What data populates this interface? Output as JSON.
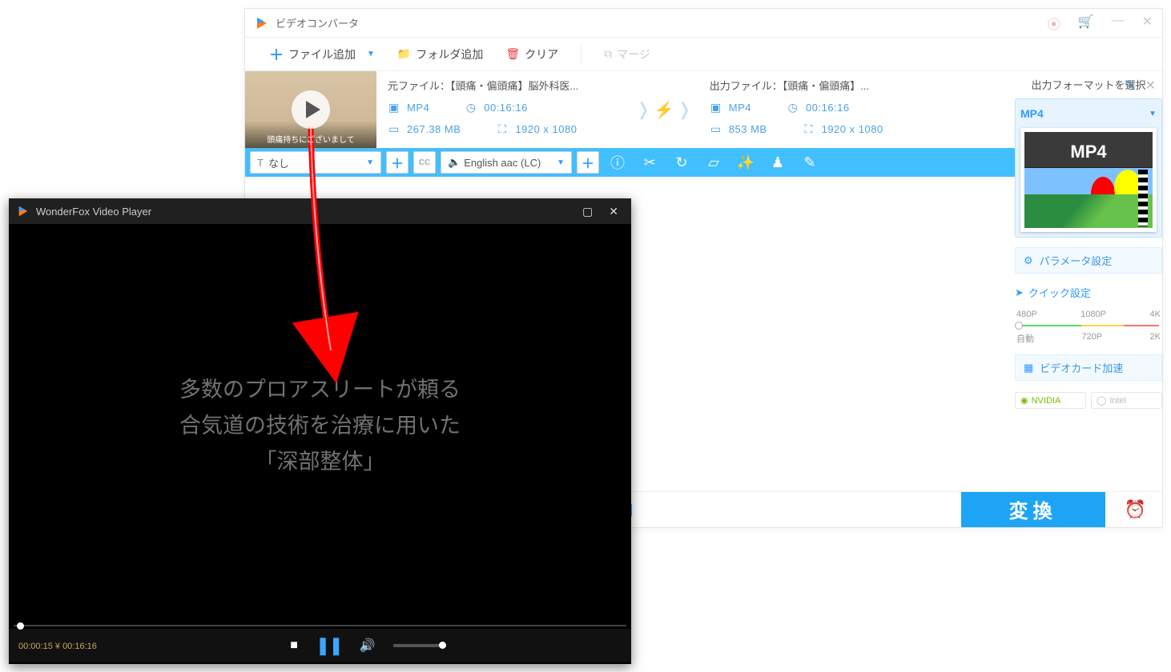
{
  "app": {
    "title": "ビデオコンバータ",
    "toolbar": {
      "add_file": "ファイル追加",
      "add_folder": "フォルダ追加",
      "clear": "クリア",
      "merge": "マージ"
    }
  },
  "task": {
    "thumb_caption": "頭痛持ちにございまして",
    "source": {
      "label": "元ファイル：",
      "name": "【頭痛・偏頭痛】脳外科医...",
      "format": "MP4",
      "duration": "00:16:16",
      "size": "267.38 MB",
      "resolution": "1920 x 1080"
    },
    "output": {
      "label": "出力ファイル：",
      "name": "【頭痛・偏頭痛】...",
      "format": "MP4",
      "duration": "00:16:16",
      "size": "853 MB",
      "resolution": "1920 x 1080"
    }
  },
  "bluebar": {
    "subtitle_none": "なし",
    "audio_track": "English aac (LC)"
  },
  "rpanel": {
    "title": "出力フォーマットを選択",
    "format": "MP4",
    "params_btn": "パラメータ設定",
    "quick_title": "クイック設定",
    "marks": {
      "p480": "480P",
      "p720": "720P",
      "p1080": "1080P",
      "p2k": "2K",
      "p4k": "4K",
      "auto": "自動"
    },
    "gpu_btn": "ビデオカード加速",
    "gpu": {
      "nvidia": "NVIDIA",
      "intel": "Intel"
    }
  },
  "bottom": {
    "convert": "変換"
  },
  "player": {
    "title": "WonderFox Video Player",
    "sub1": "多数のプロアスリートが頼る",
    "sub2": "合気道の技術を治療に用いた",
    "sub3": "「深部整体」",
    "time_current": "00:00:15",
    "time_sep": " ¥ ",
    "time_total": "00:16:16"
  }
}
